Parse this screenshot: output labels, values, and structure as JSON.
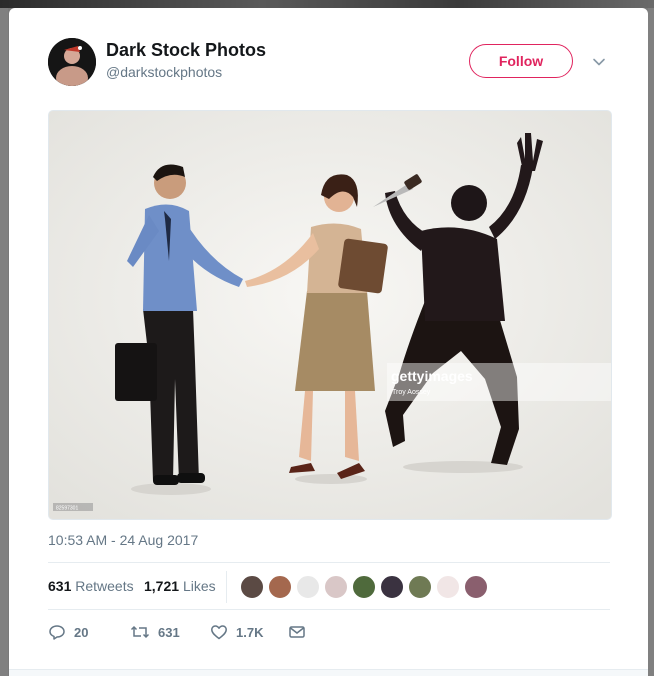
{
  "tweet": {
    "author_name": "Dark Stock Photos",
    "author_handle": "@darkstockphotos",
    "follow_label": "Follow",
    "timestamp": "10:53 AM - 24 Aug 2017",
    "retweets_count": "631",
    "retweets_label": "Retweets",
    "likes_count": "1,721",
    "likes_label": "Likes",
    "reply_count": "20",
    "retweet_action_count": "631",
    "like_action_count": "1.7K"
  },
  "photo": {
    "watermark_brand": "gettyimages",
    "watermark_credit": "Troy Aossey",
    "image_id_tag": "82597301"
  },
  "colors": {
    "follow_accent": "#e0245e",
    "secondary_text": "#657786",
    "primary_text": "#14171a"
  },
  "icons": [
    "chevron-down-icon",
    "reply-icon",
    "retweet-icon",
    "heart-icon",
    "envelope-icon"
  ]
}
